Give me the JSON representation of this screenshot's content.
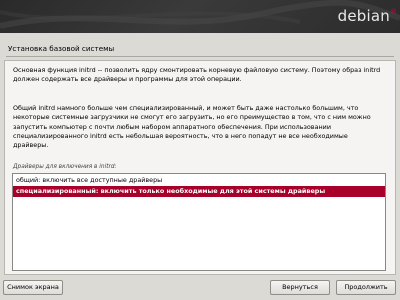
{
  "banner": {
    "logo_text": "debian",
    "logo_mark": "®"
  },
  "page": {
    "title": "Установка базовой системы"
  },
  "body": {
    "paragraph1": "Основная функция initrd -- позволить ядру смонтировать корневую файловую систему. Поэтому образ initrd должен содержать все драйверы и программы для этой операции.",
    "paragraph2": "Общий initrd намного больше чем специализированный, и может быть даже настолько большим, что некоторые системные загрузчики не смогут его загрузить, но его преимущество в том, что с ним можно запустить компьютер с почти любым набором аппаратного обеспечения. При использовании специализированного initrd есть небольшая вероятность, что в него попадут не все необходимые драйверы.",
    "list_label": "Драйверы для включения в initrd:",
    "options": [
      "общий: включить все доступные драйверы",
      "специализированный: включить только необходимые для этой системы драйверы"
    ],
    "selected_index": 1
  },
  "buttons": {
    "screenshot": "Снимок экрана",
    "back": "Вернуться",
    "continue": "Продолжить"
  },
  "colors": {
    "selection": "#a7002a",
    "banner": "#2e2e2e",
    "logo_accent": "#d0073b"
  }
}
